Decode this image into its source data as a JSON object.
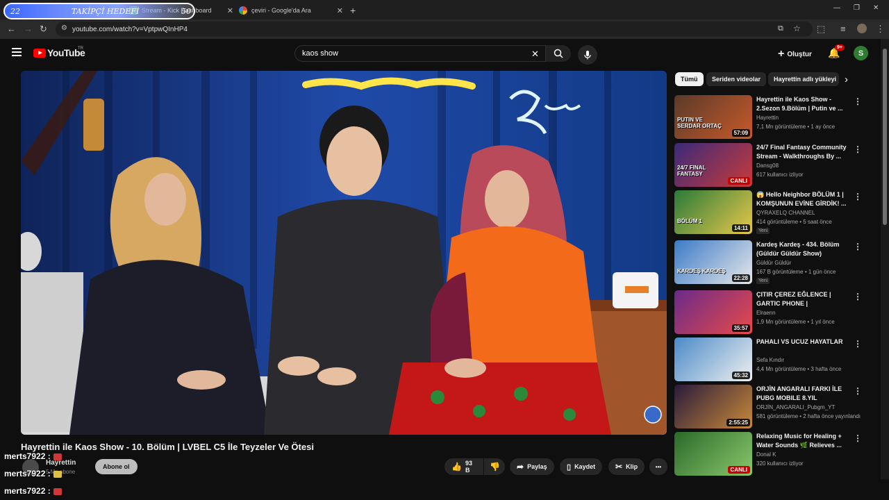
{
  "browser": {
    "tabs": [
      {
        "label": "Stream - Kick Dashboard"
      },
      {
        "label": "çeviri - Google'da Ara"
      }
    ],
    "new_tab": "+",
    "url": "youtube.com/watch?v=VptpwQInHP4",
    "window_controls": {
      "minimize": "—",
      "maximize": "❐",
      "close": "✕"
    }
  },
  "overlay": {
    "goal_current": "22",
    "goal_label": "TAKİPÇİ HEDEFİ",
    "goal_target": "50",
    "chat": [
      {
        "user": "merts7922 :"
      },
      {
        "user": "merts7922 :"
      },
      {
        "user": "merts7922 :"
      }
    ]
  },
  "youtube": {
    "logo": "YouTube",
    "logo_region": "TR",
    "search_value": "kaos show",
    "create_label": "Oluştur",
    "notif_count": "9+",
    "avatar_letter": "S"
  },
  "video": {
    "title": "Hayrettin ile Kaos Show - 10. Bölüm | LVBEL C5 İle Teyzeler Ve Ötesi",
    "channel": "Hayrettin",
    "subs": "5 Mn abone",
    "subscribe_label": "Abone ol",
    "likes": "93 B",
    "share_label": "Paylaş",
    "save_label": "Kaydet",
    "clip_label": "Klip",
    "more_label": "•••"
  },
  "chips": [
    "Tümü",
    "Seriden videolar",
    "Hayrettin adlı yükleyi"
  ],
  "recommendations": [
    {
      "title": "Hayrettin ile Kaos Show - 2.Sezon 9.Bölüm | Putin ve ...",
      "channel": "Hayrettin",
      "meta": "7,1 Mn görüntüleme • 1 ay önce",
      "duration": "57:09",
      "live": false,
      "badge": ""
    },
    {
      "title": "24/7 Final Fantasy Community Stream - Walkthroughs By ...",
      "channel": "Dansg08",
      "meta": "617 kullanıcı izliyor",
      "duration": "CANLI",
      "live": true,
      "badge": ""
    },
    {
      "title": "😱 Hello Neighbor BÖLÜM 1 | KOMŞUNUN EVİNE GİRDİK! ...",
      "channel": "QYRAXELQ CHANNEL",
      "meta": "414 görüntüleme • 5 saat önce",
      "duration": "14:11",
      "live": false,
      "badge": "Yeni"
    },
    {
      "title": "Kardeş Kardeş - 434. Bölüm (Güldür Güldür Show)",
      "channel": "Güldür Güldür",
      "meta": "167 B görüntüleme • 1 gün önce",
      "duration": "22:28",
      "live": false,
      "badge": "Yeni"
    },
    {
      "title": "ÇITIR ÇEREZ EĞLENCE | GARTIC PHONE |",
      "channel": "Elraenn",
      "meta": "1,9 Mn görüntüleme • 1 yıl önce",
      "duration": "35:57",
      "live": false,
      "badge": ""
    },
    {
      "title": "PAHALI VS UCUZ HAYATLAR",
      "channel": "Sefa Kındır",
      "meta": "4,4 Mn görüntüleme • 3 hafta önce",
      "duration": "45:32",
      "live": false,
      "badge": ""
    },
    {
      "title": "ORJİN ANGARALI FARKI İLE PUBG MOBILE 8.YIL",
      "channel": "ORJİN_ANGARALI_Pubgm_YT",
      "meta": "581 görüntüleme • 2 hafta önce yayınlandı",
      "duration": "2:55:25",
      "live": false,
      "badge": ""
    },
    {
      "title": "Relaxing Music for Healing + Water Sounds 🌿 Relieves ...",
      "channel": "Donal K",
      "meta": "320 kullanıcı izliyor",
      "duration": "CANLI",
      "live": true,
      "badge": ""
    }
  ],
  "thumb_texts": [
    "PUTIN VE SERDAR ORTAÇ",
    "24/7 FINAL FANTASY",
    "BÖLÜM 1",
    "KARDEŞ KARDEŞ"
  ],
  "colors": {
    "accent_red": "#ff0000",
    "background": "#0f0f0f",
    "goal_blue": "#3c66ff"
  }
}
